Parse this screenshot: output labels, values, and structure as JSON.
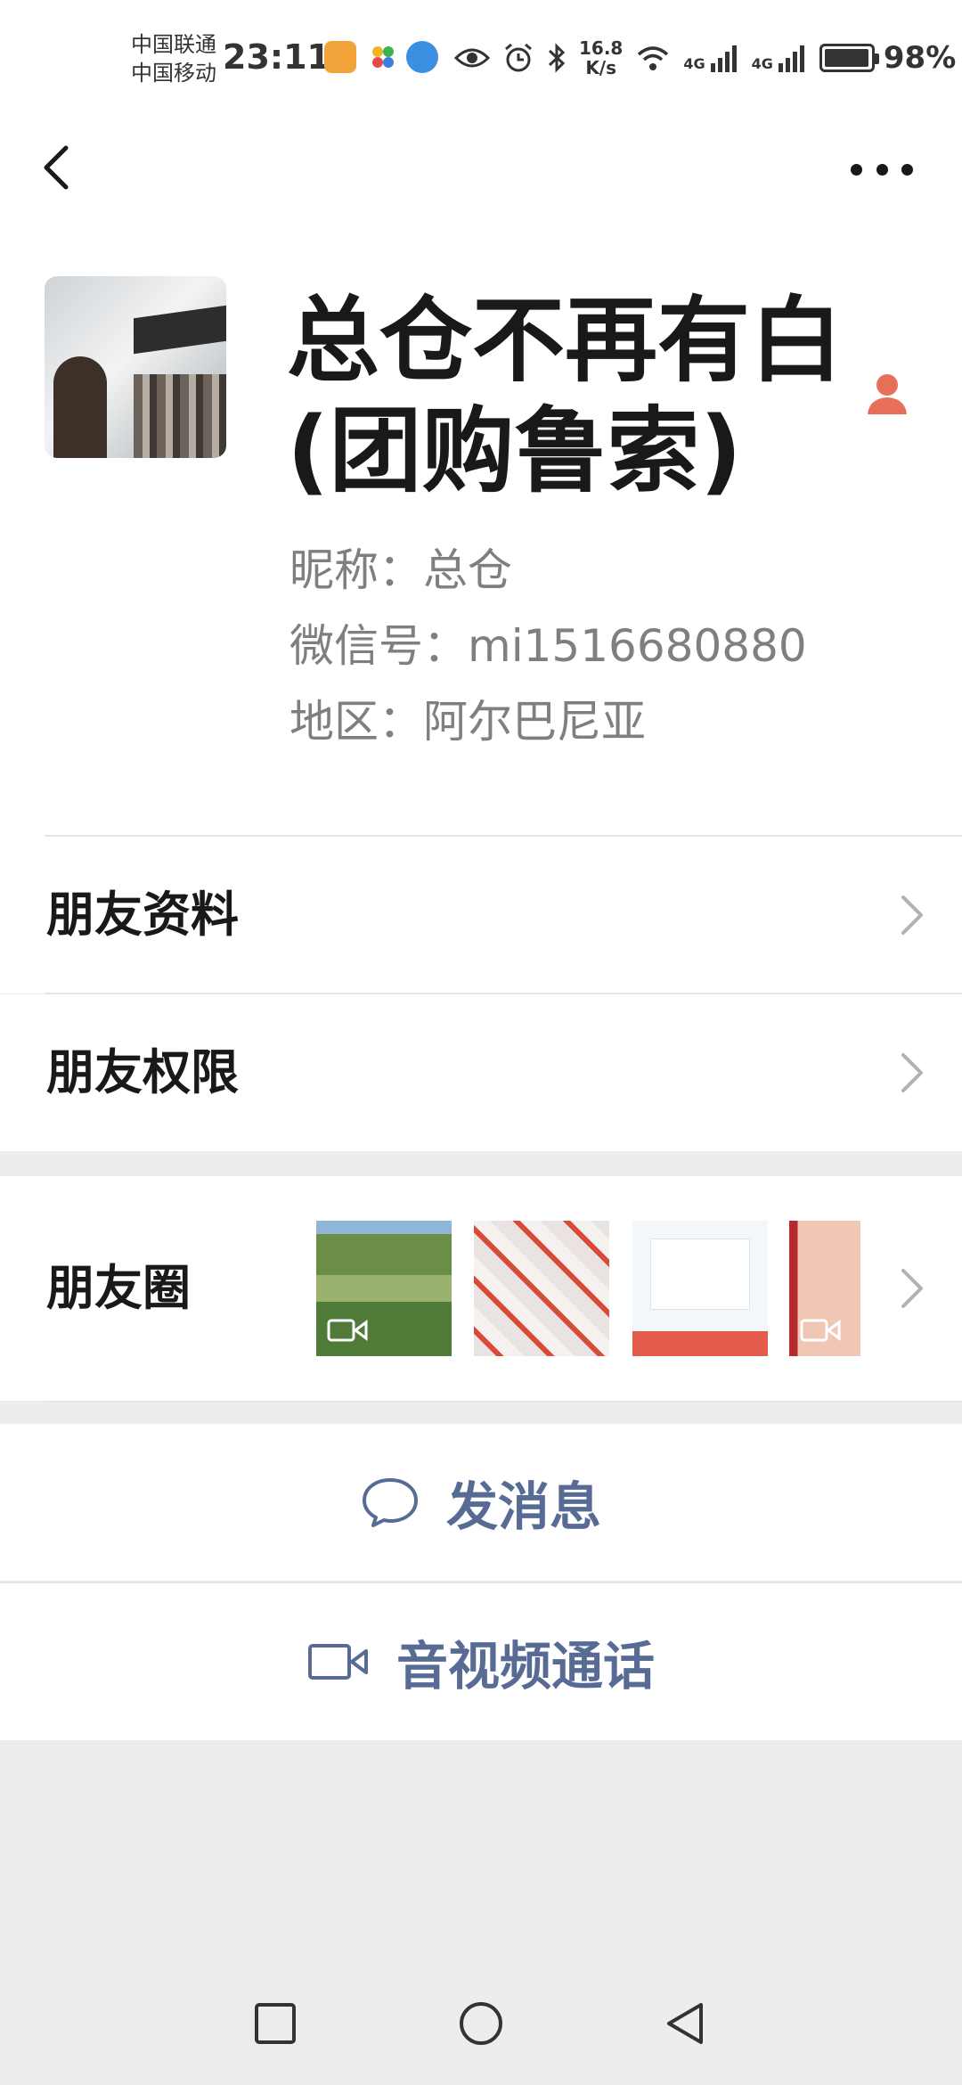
{
  "status_bar": {
    "carrier_1": "中国联通",
    "carrier_2": "中国移动",
    "time": "23:11",
    "net_speed_value": "16.8",
    "net_speed_unit": "K/s",
    "network_1": "4G",
    "network_2": "4G",
    "battery_percent": "98%",
    "battery_level": 0.98
  },
  "nav": {
    "back_icon": "chevron-left-icon",
    "more_icon": "more-dots-icon"
  },
  "profile": {
    "name_line_1": "总仓不再有白",
    "name_line_2": "(团购鲁索)",
    "nickname": "昵称：总仓",
    "wechat_id": "微信号：mi1516680880",
    "region": "地区：阿尔巴尼亚",
    "gender_icon": "female-user-icon",
    "gender_color": "#e8705a"
  },
  "rows": {
    "friend_profile": "朋友资料",
    "friend_permissions": "朋友权限",
    "moments": "朋友圈"
  },
  "actions": {
    "send_message": "发消息",
    "video_call": "音视频通话"
  },
  "colors": {
    "link": "#576b95",
    "background": "#ededed"
  }
}
